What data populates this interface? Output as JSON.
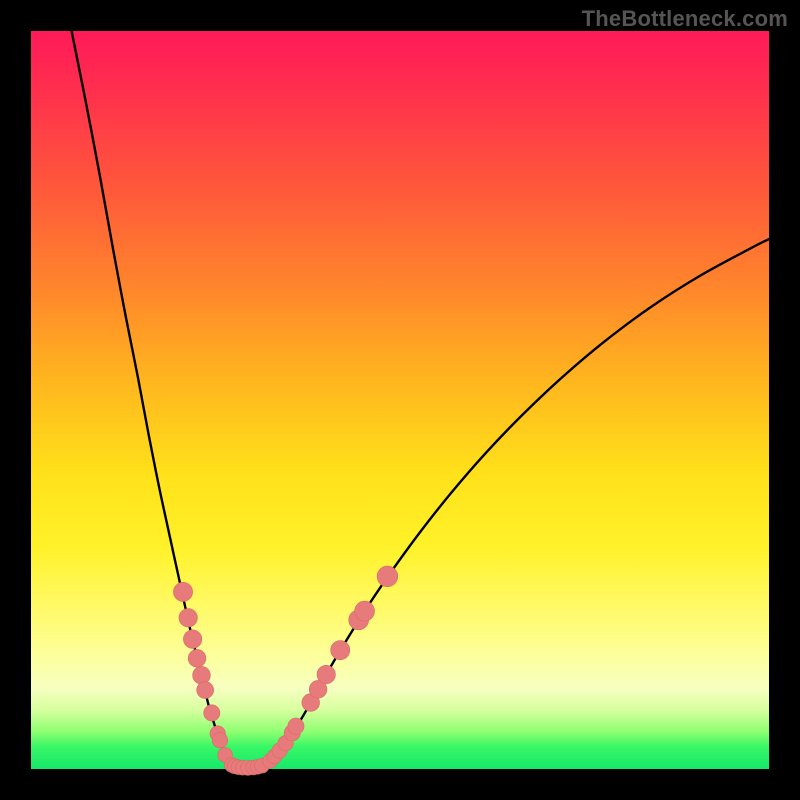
{
  "watermark": {
    "text": "TheBottleneck.com"
  },
  "colors": {
    "frame": "#000000",
    "stroke": "#000000",
    "marker_fill": "#e77a7a",
    "marker_stroke": "#d96a6a"
  },
  "chart_data": {
    "type": "line",
    "title": "",
    "xlabel": "",
    "ylabel": "",
    "xlim": [
      0,
      100
    ],
    "ylim": [
      0,
      100
    ],
    "grid": false,
    "legend": false,
    "axes_visible": false,
    "background": "rainbow-vertical",
    "series": [
      {
        "name": "left-branch",
        "x": [
          5.5,
          7.5,
          9.4,
          11.2,
          12.9,
          14.5,
          16.0,
          17.4,
          18.7,
          19.9,
          21.0,
          21.9,
          22.8,
          23.5,
          24.1,
          24.7,
          25.2,
          25.6,
          26.0,
          26.3,
          26.6,
          27.0
        ],
        "y": [
          100,
          90,
          80,
          70,
          61,
          53,
          45,
          38,
          32,
          26.5,
          21.5,
          17.5,
          14,
          11,
          8.5,
          6.5,
          5,
          3.8,
          2.8,
          2.0,
          1.3,
          0.7
        ]
      },
      {
        "name": "valley",
        "x": [
          27.0,
          27.7,
          28.5,
          29.4,
          30.2,
          31.0,
          32.0
        ],
        "y": [
          0.7,
          0.35,
          0.2,
          0.15,
          0.2,
          0.35,
          0.7
        ]
      },
      {
        "name": "right-branch",
        "x": [
          32.0,
          33.0,
          34.3,
          35.9,
          37.8,
          40.0,
          42.6,
          45.6,
          49.0,
          52.8,
          57.0,
          61.6,
          66.6,
          72.0,
          77.8,
          84.0,
          90.6,
          97.6,
          100.0
        ],
        "y": [
          0.7,
          1.6,
          3.2,
          5.6,
          8.8,
          12.8,
          17.2,
          22.0,
          27.0,
          32.2,
          37.5,
          42.8,
          48.0,
          53.1,
          58.0,
          62.6,
          66.8,
          70.6,
          71.8
        ]
      }
    ],
    "markers": [
      {
        "name": "left-cluster",
        "points": [
          {
            "x": 20.6,
            "y": 24.0,
            "r": 1.3
          },
          {
            "x": 21.3,
            "y": 20.5,
            "r": 1.25
          },
          {
            "x": 21.9,
            "y": 17.6,
            "r": 1.25
          },
          {
            "x": 22.5,
            "y": 15.0,
            "r": 1.2
          },
          {
            "x": 23.1,
            "y": 12.7,
            "r": 1.2
          },
          {
            "x": 23.6,
            "y": 10.7,
            "r": 1.15
          },
          {
            "x": 24.5,
            "y": 7.6,
            "r": 1.1
          },
          {
            "x": 25.3,
            "y": 4.8,
            "r": 1.05
          },
          {
            "x": 25.6,
            "y": 3.9,
            "r": 1.05
          },
          {
            "x": 26.3,
            "y": 1.9,
            "r": 1.0
          }
        ]
      },
      {
        "name": "valley-cluster",
        "points": [
          {
            "x": 27.2,
            "y": 0.55,
            "r": 1.0
          },
          {
            "x": 27.6,
            "y": 0.37,
            "r": 1.0
          },
          {
            "x": 28.1,
            "y": 0.25,
            "r": 1.0
          },
          {
            "x": 28.7,
            "y": 0.18,
            "r": 1.0
          },
          {
            "x": 29.4,
            "y": 0.15,
            "r": 1.0
          },
          {
            "x": 30.1,
            "y": 0.2,
            "r": 1.0
          },
          {
            "x": 30.7,
            "y": 0.3,
            "r": 1.0
          },
          {
            "x": 31.3,
            "y": 0.45,
            "r": 1.0
          }
        ]
      },
      {
        "name": "right-cluster",
        "points": [
          {
            "x": 32.4,
            "y": 1.1,
            "r": 1.0
          },
          {
            "x": 33.0,
            "y": 1.7,
            "r": 1.0
          },
          {
            "x": 33.7,
            "y": 2.5,
            "r": 1.05
          },
          {
            "x": 34.5,
            "y": 3.5,
            "r": 1.05
          },
          {
            "x": 35.4,
            "y": 4.9,
            "r": 1.1
          },
          {
            "x": 35.9,
            "y": 5.8,
            "r": 1.1
          },
          {
            "x": 37.9,
            "y": 9.0,
            "r": 1.2
          },
          {
            "x": 38.9,
            "y": 10.8,
            "r": 1.2
          },
          {
            "x": 40.0,
            "y": 12.8,
            "r": 1.25
          },
          {
            "x": 41.9,
            "y": 16.1,
            "r": 1.3
          },
          {
            "x": 44.4,
            "y": 20.2,
            "r": 1.35
          },
          {
            "x": 45.2,
            "y": 21.4,
            "r": 1.35
          },
          {
            "x": 48.3,
            "y": 26.1,
            "r": 1.4
          }
        ]
      }
    ]
  }
}
